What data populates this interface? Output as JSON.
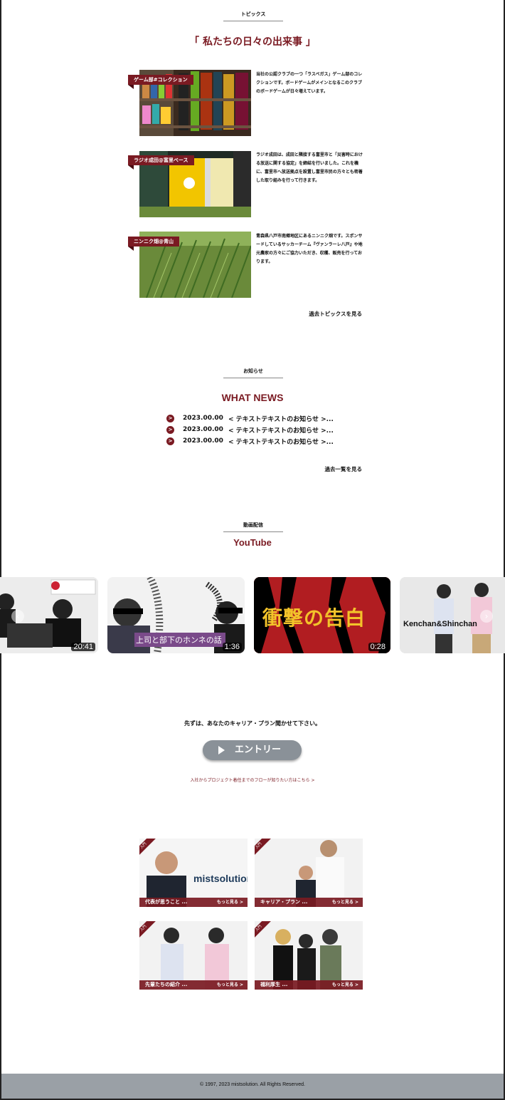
{
  "topics": {
    "label": "トピックス",
    "heading": "「 私たちの日々の出来事 」",
    "items": [
      {
        "tag": "ゲーム部#コレクション",
        "text": "当社の公認クラブの一つ「ラスベガス」ゲーム部のコレクションです。ボードゲームがメインとなるこのクラブのボードゲームが日々増えています。"
      },
      {
        "tag": "ラジオ成田@富里ベース",
        "text": "ラジオ成田は、成田と隣接する富里市と「災害時における放送に関する協定」を締結を行いました。これを機に、富里市へ放送拠点を設置し富里市民の方々とも密着した取り組みを行って行きます。"
      },
      {
        "tag": "ニンニク畑@青山",
        "text": "青森県八戸市南郷地区にあるニンニク畑です。スポンサードしているサッカーチーム『ヴァンラーレ八戸』や地元農家の方々にご協力いただき、収穫、販売を行っております。"
      }
    ],
    "more": "過去トピックスを見る"
  },
  "news": {
    "label": "お知らせ",
    "heading": "WHAT NEWS",
    "bullet": ">",
    "items": [
      {
        "date": "2023.00.00",
        "title": "< テキストテキストのお知らせ >..."
      },
      {
        "date": "2023.00.00",
        "title": "< テキストテキストのお知らせ >..."
      },
      {
        "date": "2023.00.00",
        "title": "< テキストテキストのお知らせ >..."
      }
    ],
    "more": "過去一覧を見る"
  },
  "videos": {
    "label": "動画配信",
    "heading": "YouTube",
    "items": [
      {
        "duration": "20:41",
        "overlay": ""
      },
      {
        "duration": "1:36",
        "overlay": "上司と部下のホンネの話"
      },
      {
        "duration": "0:28",
        "overlay": "衝撃の告白"
      },
      {
        "duration": "",
        "overlay": "Kenchan&Shinchan"
      }
    ],
    "prev_icon": "chevron-left-icon",
    "next_icon": "chevron-right-icon"
  },
  "entry": {
    "lead": "先ずは、あなたのキャリア・プラン聞かせて下さい。",
    "button": "エントリー",
    "flow_link": "入社からプロジェクト着任までのフローが知りたい方はこちら >"
  },
  "banners": [
    {
      "ribbon": "入門",
      "title": "代表が思うこと ...",
      "more": "もっと見る >",
      "logo": "mistsolution"
    },
    {
      "ribbon": "入門",
      "title": "キャリア・プラン ...",
      "more": "もっと見る >"
    },
    {
      "ribbon": "入門",
      "title": "先輩たちの紹介 ...",
      "more": "もっと見る >"
    },
    {
      "ribbon": "入門",
      "title": "福利厚生 ...",
      "more": "もっと見る >"
    }
  ],
  "footer": {
    "copyright": "© 1997, 2023 mistsolution. All Rights Reserved."
  },
  "colors": {
    "accent": "#7a1a22",
    "footer_bg": "#9aa0a6",
    "entry_button": "#8a9198"
  }
}
